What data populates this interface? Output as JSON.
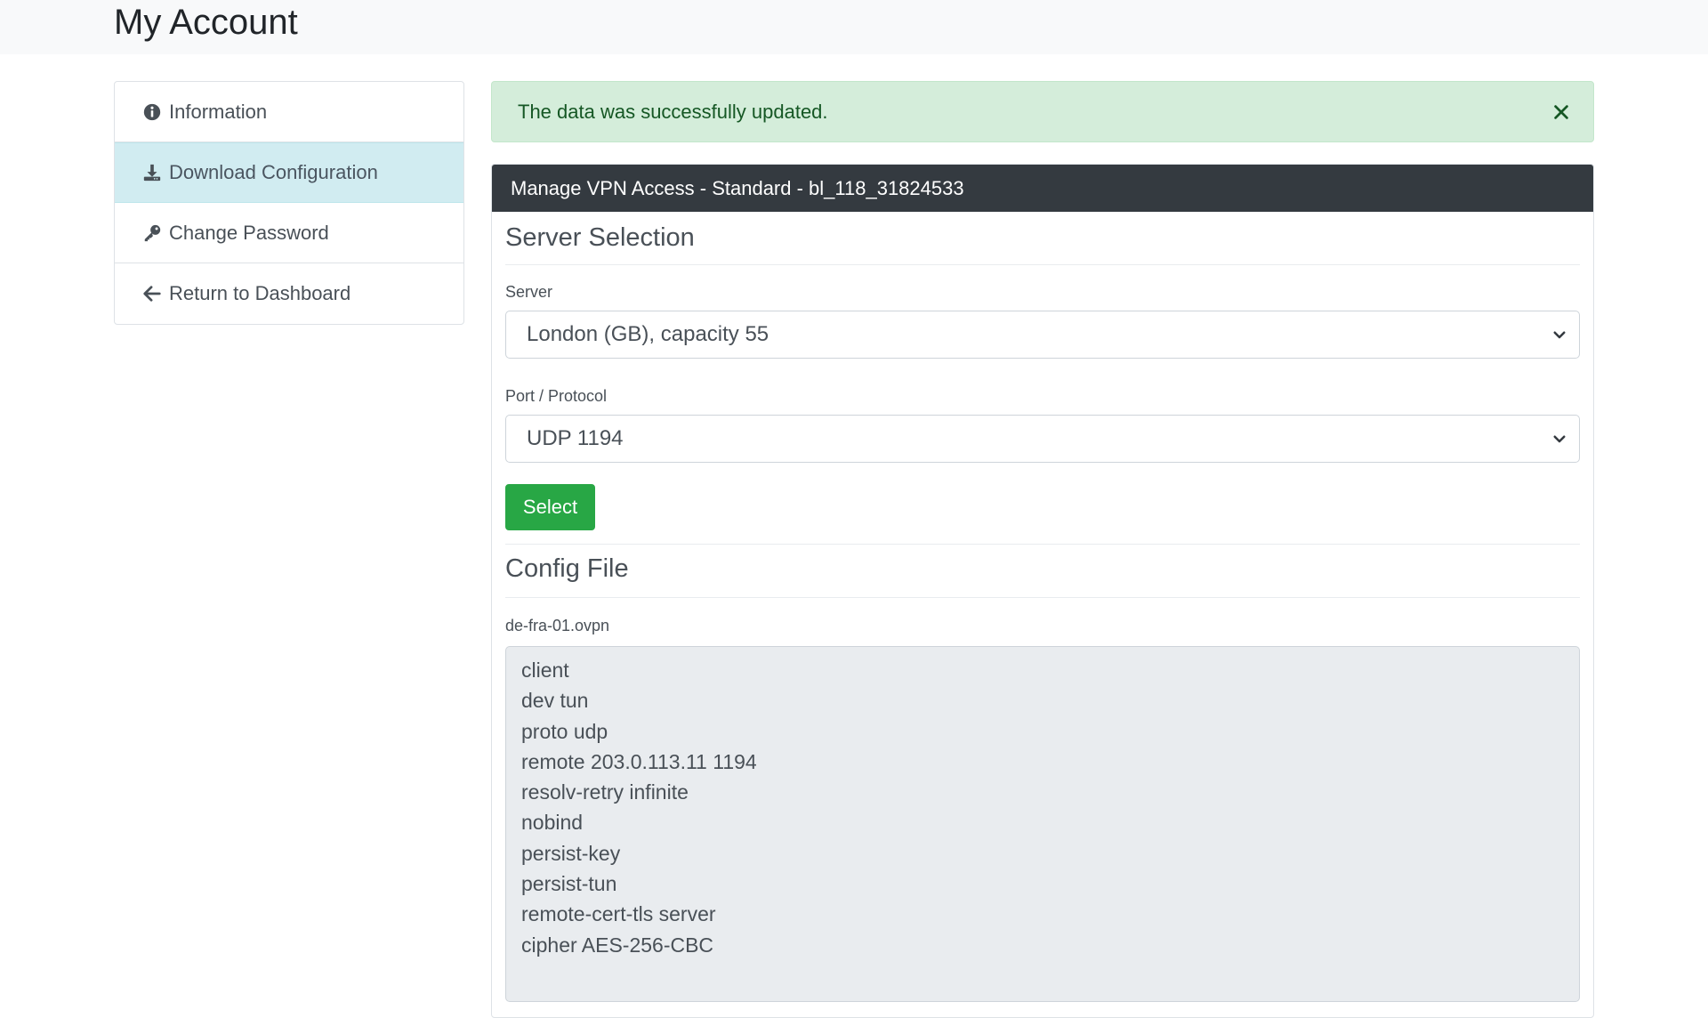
{
  "page": {
    "title": "My Account"
  },
  "sidebar": {
    "items": [
      {
        "label": "Information",
        "icon": "info-circle-icon",
        "active": false
      },
      {
        "label": "Download Configuration",
        "icon": "download-icon",
        "active": true
      },
      {
        "label": "Change Password",
        "icon": "key-icon",
        "active": false
      },
      {
        "label": "Return to Dashboard",
        "icon": "arrow-left-icon",
        "active": false
      }
    ]
  },
  "alert": {
    "message": "The data was successfully updated.",
    "close_icon": "close-icon"
  },
  "card": {
    "header": "Manage VPN Access - Standard - bl_118_31824533",
    "server_section": {
      "title": "Server Selection",
      "server_label": "Server",
      "server_value": "London (GB), capacity 55",
      "port_label": "Port / Protocol",
      "port_value": "UDP 1194",
      "select_button": "Select"
    },
    "config_section": {
      "title": "Config File",
      "file_name": "de-fra-01.ovpn",
      "lines": [
        "client",
        "dev tun",
        "proto udp",
        "remote 203.0.113.11 1194",
        "resolv-retry infinite",
        "nobind",
        "persist-key",
        "persist-tun",
        "remote-cert-tls server",
        "cipher AES-256-CBC"
      ]
    }
  },
  "colors": {
    "active_item_bg": "#d1ecf1",
    "alert_bg": "#d4edda",
    "alert_text": "#155724",
    "card_header_bg": "#343a40",
    "button_green": "#28a745",
    "textarea_bg": "#e9ecef"
  }
}
